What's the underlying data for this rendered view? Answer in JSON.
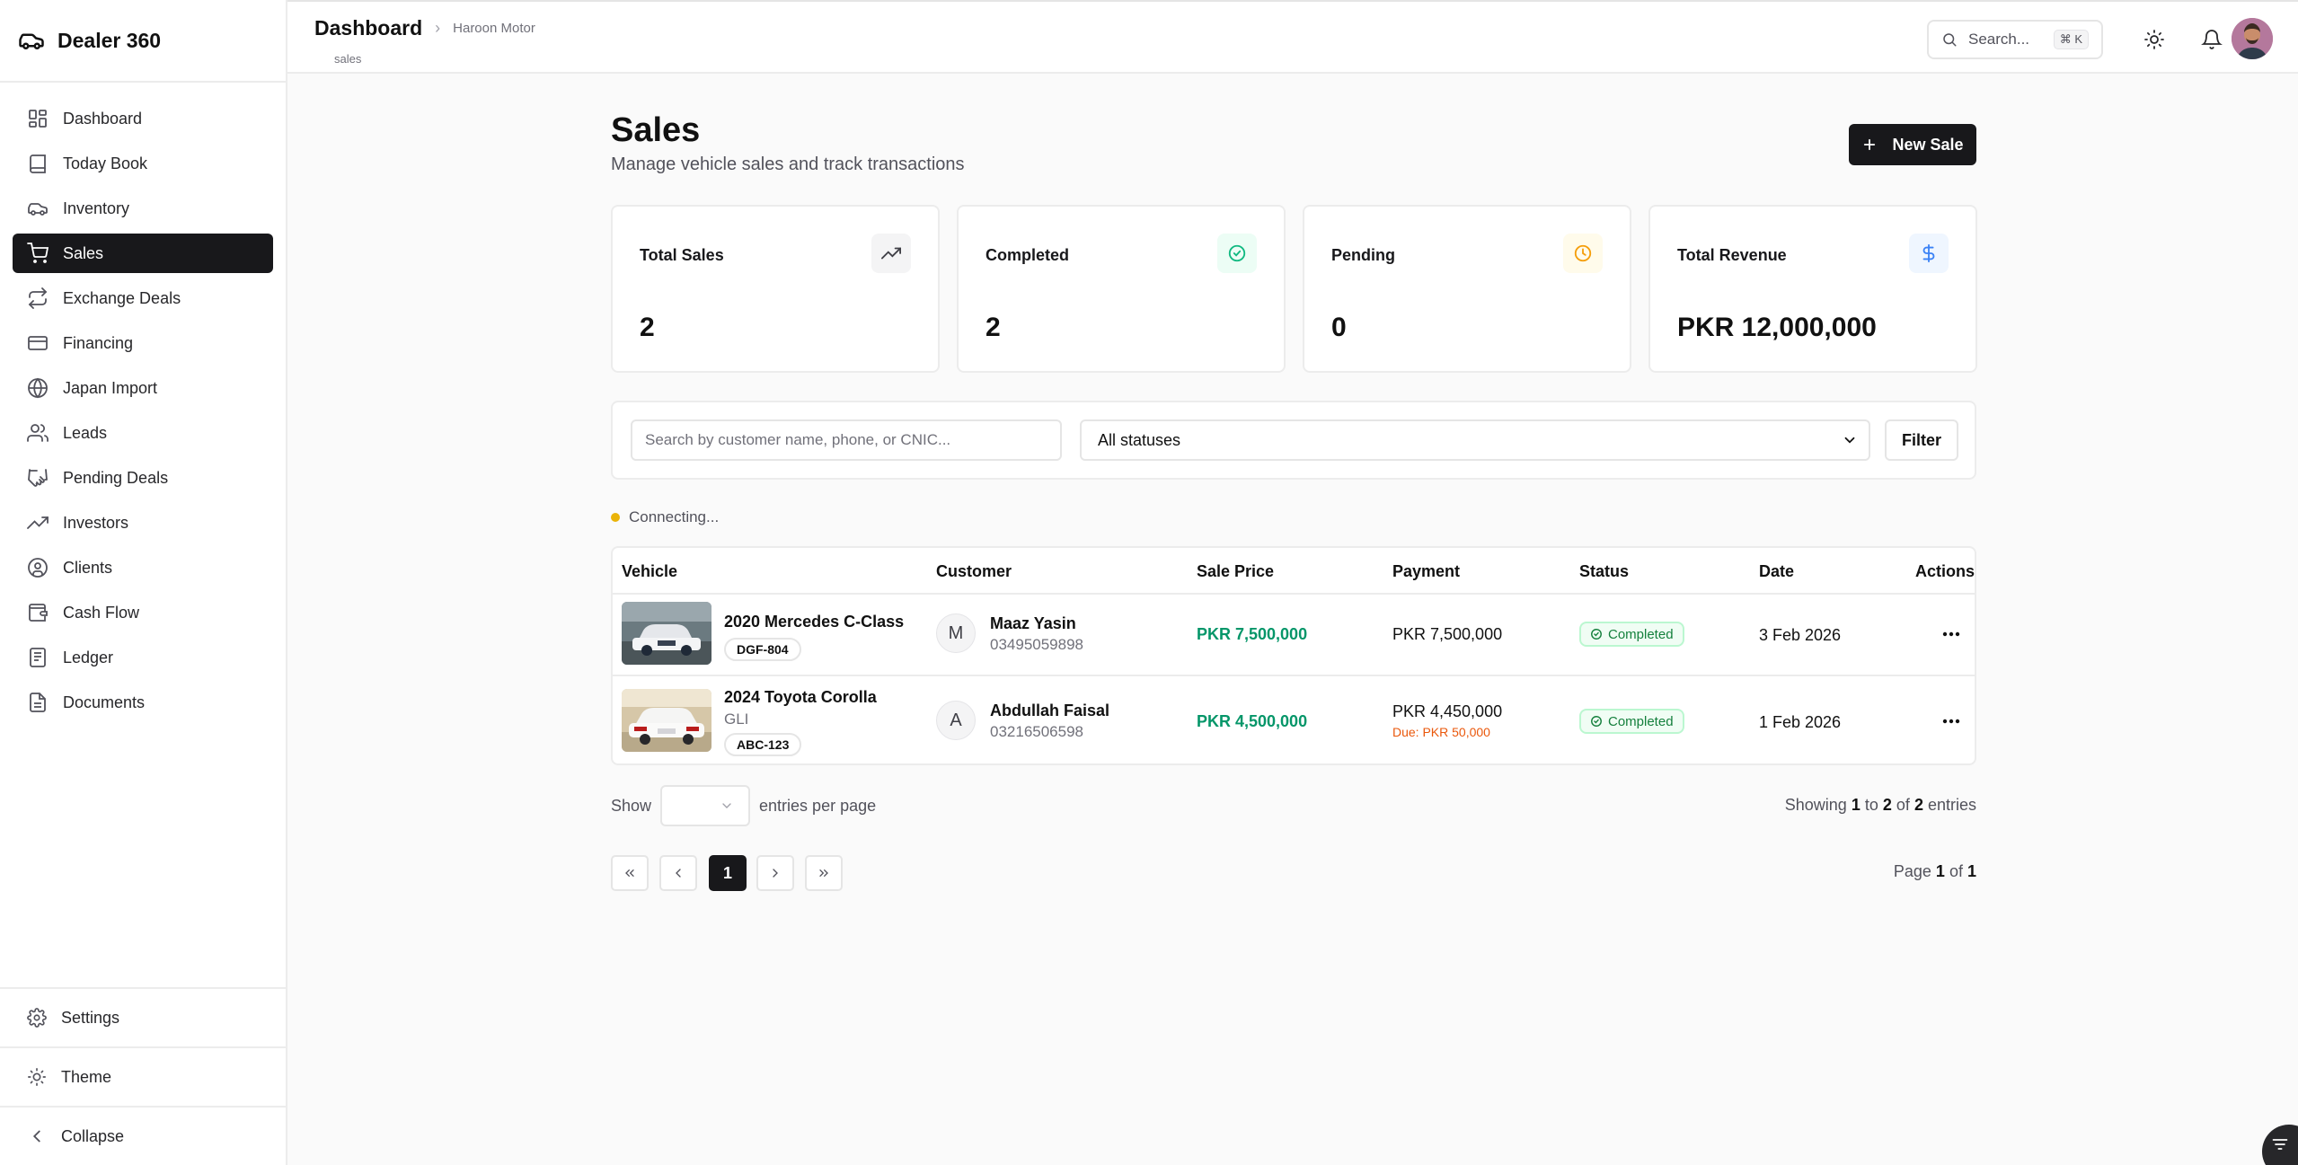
{
  "app": {
    "name": "Dealer 360"
  },
  "sidebar": {
    "items": [
      {
        "label": "Dashboard",
        "icon": "dashboard-icon"
      },
      {
        "label": "Today Book",
        "icon": "book-icon"
      },
      {
        "label": "Inventory",
        "icon": "car-icon"
      },
      {
        "label": "Sales",
        "icon": "cart-icon",
        "active": true
      },
      {
        "label": "Exchange Deals",
        "icon": "exchange-icon"
      },
      {
        "label": "Financing",
        "icon": "credit-card-icon"
      },
      {
        "label": "Japan Import",
        "icon": "globe-icon"
      },
      {
        "label": "Leads",
        "icon": "users-icon"
      },
      {
        "label": "Pending Deals",
        "icon": "handshake-icon"
      },
      {
        "label": "Investors",
        "icon": "trending-up-icon"
      },
      {
        "label": "Clients",
        "icon": "user-circle-icon"
      },
      {
        "label": "Cash Flow",
        "icon": "wallet-icon"
      },
      {
        "label": "Ledger",
        "icon": "ledger-icon"
      },
      {
        "label": "Documents",
        "icon": "document-icon"
      }
    ],
    "settings_label": "Settings",
    "theme_label": "Theme",
    "collapse_label": "Collapse"
  },
  "header": {
    "breadcrumb_main": "Dashboard",
    "breadcrumb_sub": "Haroon Motor",
    "path": "sales",
    "search_placeholder": "Search...",
    "search_shortcut": "⌘ K"
  },
  "page": {
    "title": "Sales",
    "subtitle": "Manage vehicle sales and track transactions",
    "new_button": "New Sale"
  },
  "stats": [
    {
      "label": "Total Sales",
      "value": "2",
      "icon": "trending-up-icon",
      "color": "#3f3f46",
      "bg": "#f4f4f5"
    },
    {
      "label": "Completed",
      "value": "2",
      "icon": "check-circle-icon",
      "color": "#10b981",
      "bg": "#ecfdf5"
    },
    {
      "label": "Pending",
      "value": "0",
      "icon": "clock-icon",
      "color": "#f59e0b",
      "bg": "#fffbeb"
    },
    {
      "label": "Total Revenue",
      "value": "PKR 12,000,000",
      "icon": "dollar-icon",
      "color": "#3b82f6",
      "bg": "#eff6ff"
    }
  ],
  "filters": {
    "search_placeholder": "Search by customer name, phone, or CNIC...",
    "status_value": "All statuses",
    "filter_button": "Filter"
  },
  "connection": {
    "status": "Connecting..."
  },
  "table": {
    "columns": [
      "Vehicle",
      "Customer",
      "Sale Price",
      "Payment",
      "Status",
      "Date",
      "Actions"
    ],
    "rows": [
      {
        "vehicle": "2020 Mercedes C-Class",
        "plate": "DGF-804",
        "customer_initial": "M",
        "customer": "Maaz Yasin",
        "phone": "03495059898",
        "sale_price": "PKR 7,500,000",
        "payment": "PKR 7,500,000",
        "status": "Completed",
        "date": "3 Feb 2026"
      },
      {
        "vehicle": "2024 Toyota Corolla",
        "trim": "GLI",
        "plate": "ABC-123",
        "customer_initial": "A",
        "customer": "Abdullah Faisal",
        "phone": "03216506598",
        "sale_price": "PKR 4,500,000",
        "payment": "PKR 4,450,000",
        "due": "Due: PKR 50,000",
        "status": "Completed",
        "date": "1 Feb 2026"
      }
    ]
  },
  "pagination": {
    "show_label": "Show",
    "per_page_label": "entries per page",
    "showing_prefix": "Showing",
    "showing_from": "1",
    "showing_to_word": "to",
    "showing_to": "2",
    "showing_of_word": "of",
    "showing_total": "2",
    "showing_suffix": "entries",
    "current_page": "1",
    "page_word": "Page",
    "of_word": "of",
    "total_pages": "1"
  }
}
